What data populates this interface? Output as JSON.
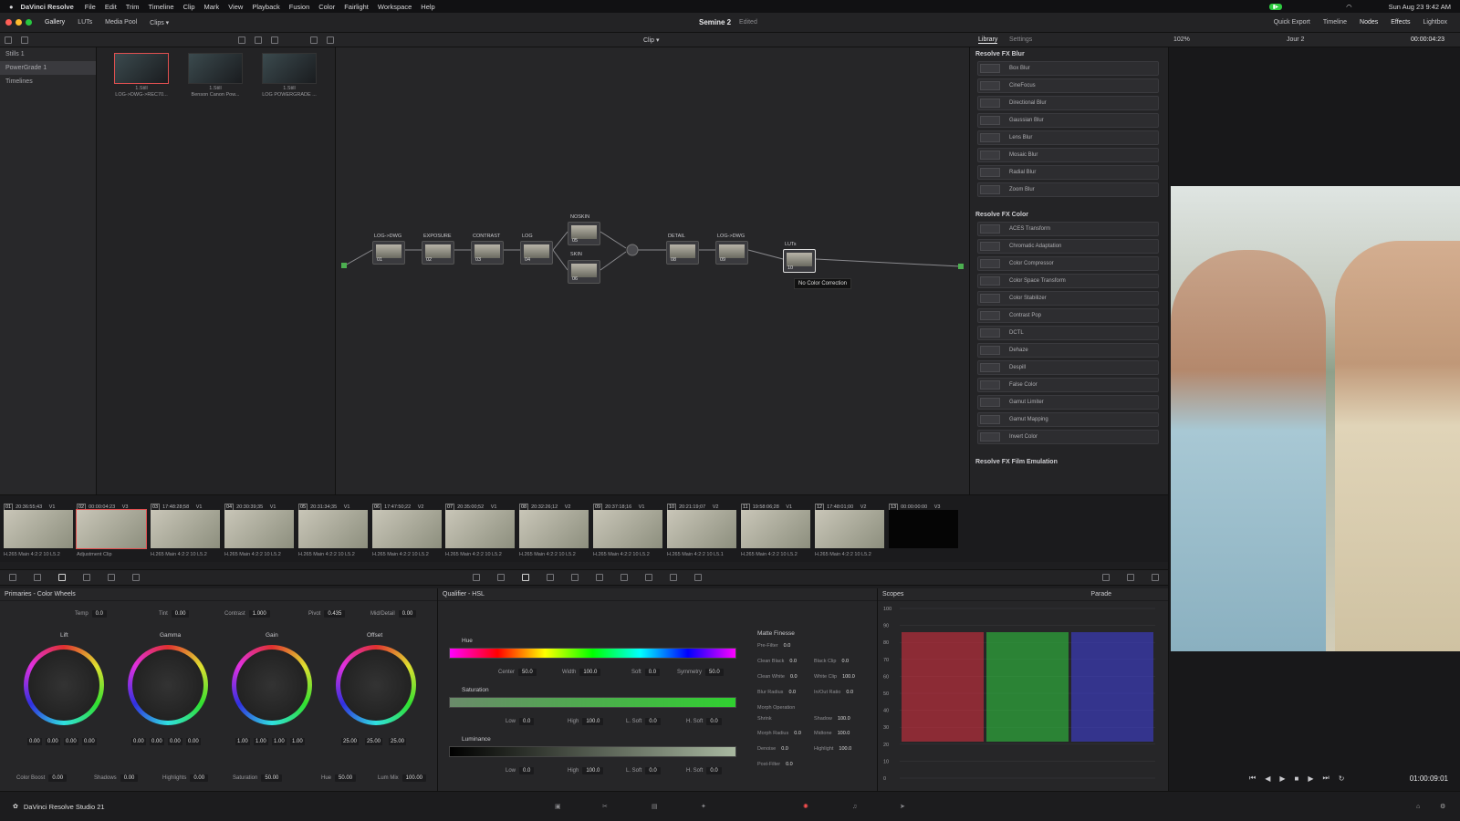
{
  "menubar": {
    "app": "DaVinci Resolve",
    "items": [
      "File",
      "Edit",
      "Trim",
      "Timeline",
      "Clip",
      "Mark",
      "View",
      "Playback",
      "Fusion",
      "Color",
      "Fairlight",
      "Workspace",
      "Help"
    ],
    "clock": "Sun Aug 23  9:42 AM"
  },
  "titlebar": {
    "gallery": "Gallery",
    "luts": "LUTs",
    "media_pool": "Media Pool",
    "clips": "Clips",
    "project": "Semine 2",
    "status": "Edited",
    "quick_export": "Quick Export",
    "timeline": "Timeline",
    "nodes": "Nodes",
    "effects": "Effects",
    "lightbox": "Lightbox"
  },
  "toolbar": {
    "clip_mode": "Clip",
    "library_tab": "Library",
    "settings_tab": "Settings",
    "zoom": "102%",
    "timeline_name": "Jour 2",
    "timecode": "00:00:04:23"
  },
  "stills_panel": {
    "items": [
      "Stills 1",
      "PowerGrade 1",
      "Timelines"
    ]
  },
  "gallery": {
    "stills": [
      {
        "label": "1.Still",
        "sub": "LOG->DWG->REC70..."
      },
      {
        "label": "1.Still",
        "sub": "Benson Canon Pow..."
      },
      {
        "label": "1.Still",
        "sub": "LOG POWERGRADE ..."
      }
    ]
  },
  "nodes": {
    "list": [
      {
        "label": "LOG->DWG",
        "num": "01"
      },
      {
        "label": "EXPOSURE",
        "num": "02"
      },
      {
        "label": "CONTRAST",
        "num": "03"
      },
      {
        "label": "LOG",
        "num": "04"
      },
      {
        "label": "NOSKIN",
        "num": "05"
      },
      {
        "label": "SKIN",
        "num": "06"
      },
      {
        "label": "DETAIL",
        "num": "08"
      },
      {
        "label": "LOG->DWG",
        "num": "09"
      },
      {
        "label": "LUTs",
        "num": "10"
      }
    ],
    "tooltip": "No Color Correction"
  },
  "library": {
    "sections": [
      {
        "title": "Resolve FX Blur",
        "items": [
          "Box Blur",
          "CineFocus",
          "Directional Blur",
          "Gaussian Blur",
          "Lens Blur",
          "Mosaic Blur",
          "Radial Blur",
          "Zoom Blur"
        ]
      },
      {
        "title": "Resolve FX Color",
        "items": [
          "ACES Transform",
          "Chromatic Adaptation",
          "Color Compressor",
          "Color Space Transform",
          "Color Stabilizer",
          "Contrast Pop",
          "DCTL",
          "Dehaze",
          "Despill",
          "False Color",
          "Gamut Limiter",
          "Gamut Mapping",
          "Invert Color"
        ]
      },
      {
        "title": "Resolve FX Film Emulation",
        "items": []
      }
    ]
  },
  "timeline": {
    "clips": [
      {
        "num": "01",
        "tc": "20:36:55;43",
        "track": "V1",
        "fmt": "H.265 Main 4:2:2 10 L5.2"
      },
      {
        "num": "02",
        "tc": "00:00:04:23",
        "track": "V3",
        "fmt": "Adjustment Clip"
      },
      {
        "num": "03",
        "tc": "17:48:28;58",
        "track": "V1",
        "fmt": "H.265 Main 4:2:2 10 L5.2"
      },
      {
        "num": "04",
        "tc": "20:30:39;35",
        "track": "V1",
        "fmt": "H.265 Main 4:2:2 10 L5.2"
      },
      {
        "num": "05",
        "tc": "20:31:34;35",
        "track": "V1",
        "fmt": "H.265 Main 4:2:2 10 L5.2"
      },
      {
        "num": "06",
        "tc": "17:47:50;22",
        "track": "V2",
        "fmt": "H.265 Main 4:2:2 10 L5.2"
      },
      {
        "num": "07",
        "tc": "20:35:00;52",
        "track": "V1",
        "fmt": "H.265 Main 4:2:2 10 L5.2"
      },
      {
        "num": "08",
        "tc": "20:32:26;12",
        "track": "V2",
        "fmt": "H.265 Main 4:2:2 10 L5.2"
      },
      {
        "num": "09",
        "tc": "20:37:18;16",
        "track": "V1",
        "fmt": "H.265 Main 4:2:2 10 L5.2"
      },
      {
        "num": "10",
        "tc": "20:21:19;07",
        "track": "V2",
        "fmt": "H.265 Main 4:2:2 10 L5.1"
      },
      {
        "num": "11",
        "tc": "19:58:06;28",
        "track": "V1",
        "fmt": "H.265 Main 4:2:2 10 L5.2"
      },
      {
        "num": "12",
        "tc": "17:48:01;00",
        "track": "V2",
        "fmt": "H.265 Main 4:2:2 10 L5.2"
      },
      {
        "num": "13",
        "tc": "00:00:00:00",
        "track": "V3",
        "fmt": ""
      }
    ]
  },
  "primaries": {
    "title": "Primaries - Color Wheels",
    "temp_label": "Temp",
    "temp": "0.0",
    "tint_label": "Tint",
    "tint": "0.00",
    "contrast_label": "Contrast",
    "contrast": "1.000",
    "pivot_label": "Pivot",
    "pivot": "0.435",
    "middetail_label": "Mid/Detail",
    "middetail": "0.00",
    "wheels": [
      {
        "name": "Lift",
        "vals": [
          "0.00",
          "0.00",
          "0.00",
          "0.00"
        ]
      },
      {
        "name": "Gamma",
        "vals": [
          "0.00",
          "0.00",
          "0.00",
          "0.00"
        ]
      },
      {
        "name": "Gain",
        "vals": [
          "1.00",
          "1.00",
          "1.00",
          "1.00"
        ]
      },
      {
        "name": "Offset",
        "vals": [
          "25.00",
          "25.00",
          "25.00"
        ]
      }
    ],
    "colorboost_label": "Color Boost",
    "colorboost": "0.00",
    "shadows_label": "Shadows",
    "shadows": "0.00",
    "highlights_label": "Highlights",
    "highlights": "0.00",
    "saturation_label": "Saturation",
    "saturation": "50.00",
    "hue_label": "Hue",
    "hue": "50.00",
    "lummix_label": "Lum Mix",
    "lummix": "100.00"
  },
  "qualifier": {
    "title": "Qualifier - HSL",
    "hue": "Hue",
    "center_label": "Center",
    "center": "50.0",
    "width_label": "Width",
    "width": "100.0",
    "soft_label": "Soft",
    "soft": "0.0",
    "symmetry_label": "Symmetry",
    "symmetry": "50.0",
    "saturation": "Saturation",
    "luminance": "Luminance",
    "low_label": "Low",
    "low": "0.0",
    "high_label": "High",
    "high": "100.0",
    "lsoft_label": "L. Soft",
    "lsoft": "0.0",
    "hsoft_label": "H. Soft",
    "hsoft": "0.0",
    "matte_title": "Matte Finesse",
    "matte": [
      [
        "Pre-Filter",
        "0.0"
      ],
      [
        "Clean Black",
        "0.0"
      ],
      [
        "Black Clip",
        "0.0"
      ],
      [
        "Clean White",
        "0.0"
      ],
      [
        "White Clip",
        "100.0"
      ],
      [
        "Blur Radius",
        "0.0"
      ],
      [
        "In/Out Ratio",
        "0.0"
      ],
      [
        "Morph Operation",
        ""
      ],
      [
        "Shrink",
        ""
      ],
      [
        "Shadow",
        "100.0"
      ],
      [
        "Morph Radius",
        "0.0"
      ],
      [
        "Midtone",
        "100.0"
      ],
      [
        "Denoise",
        "0.0"
      ],
      [
        "Highlight",
        "100.0"
      ],
      [
        "Post-Filter",
        "0.0"
      ]
    ]
  },
  "scopes": {
    "title": "Scopes",
    "mode": "Parade",
    "scale": [
      "100",
      "90",
      "80",
      "70",
      "60",
      "50",
      "40",
      "30",
      "20",
      "10",
      "0"
    ]
  },
  "viewer": {
    "timecode": "01:00:09:01"
  },
  "bottombar": {
    "app": "DaVinci Resolve Studio 21"
  }
}
